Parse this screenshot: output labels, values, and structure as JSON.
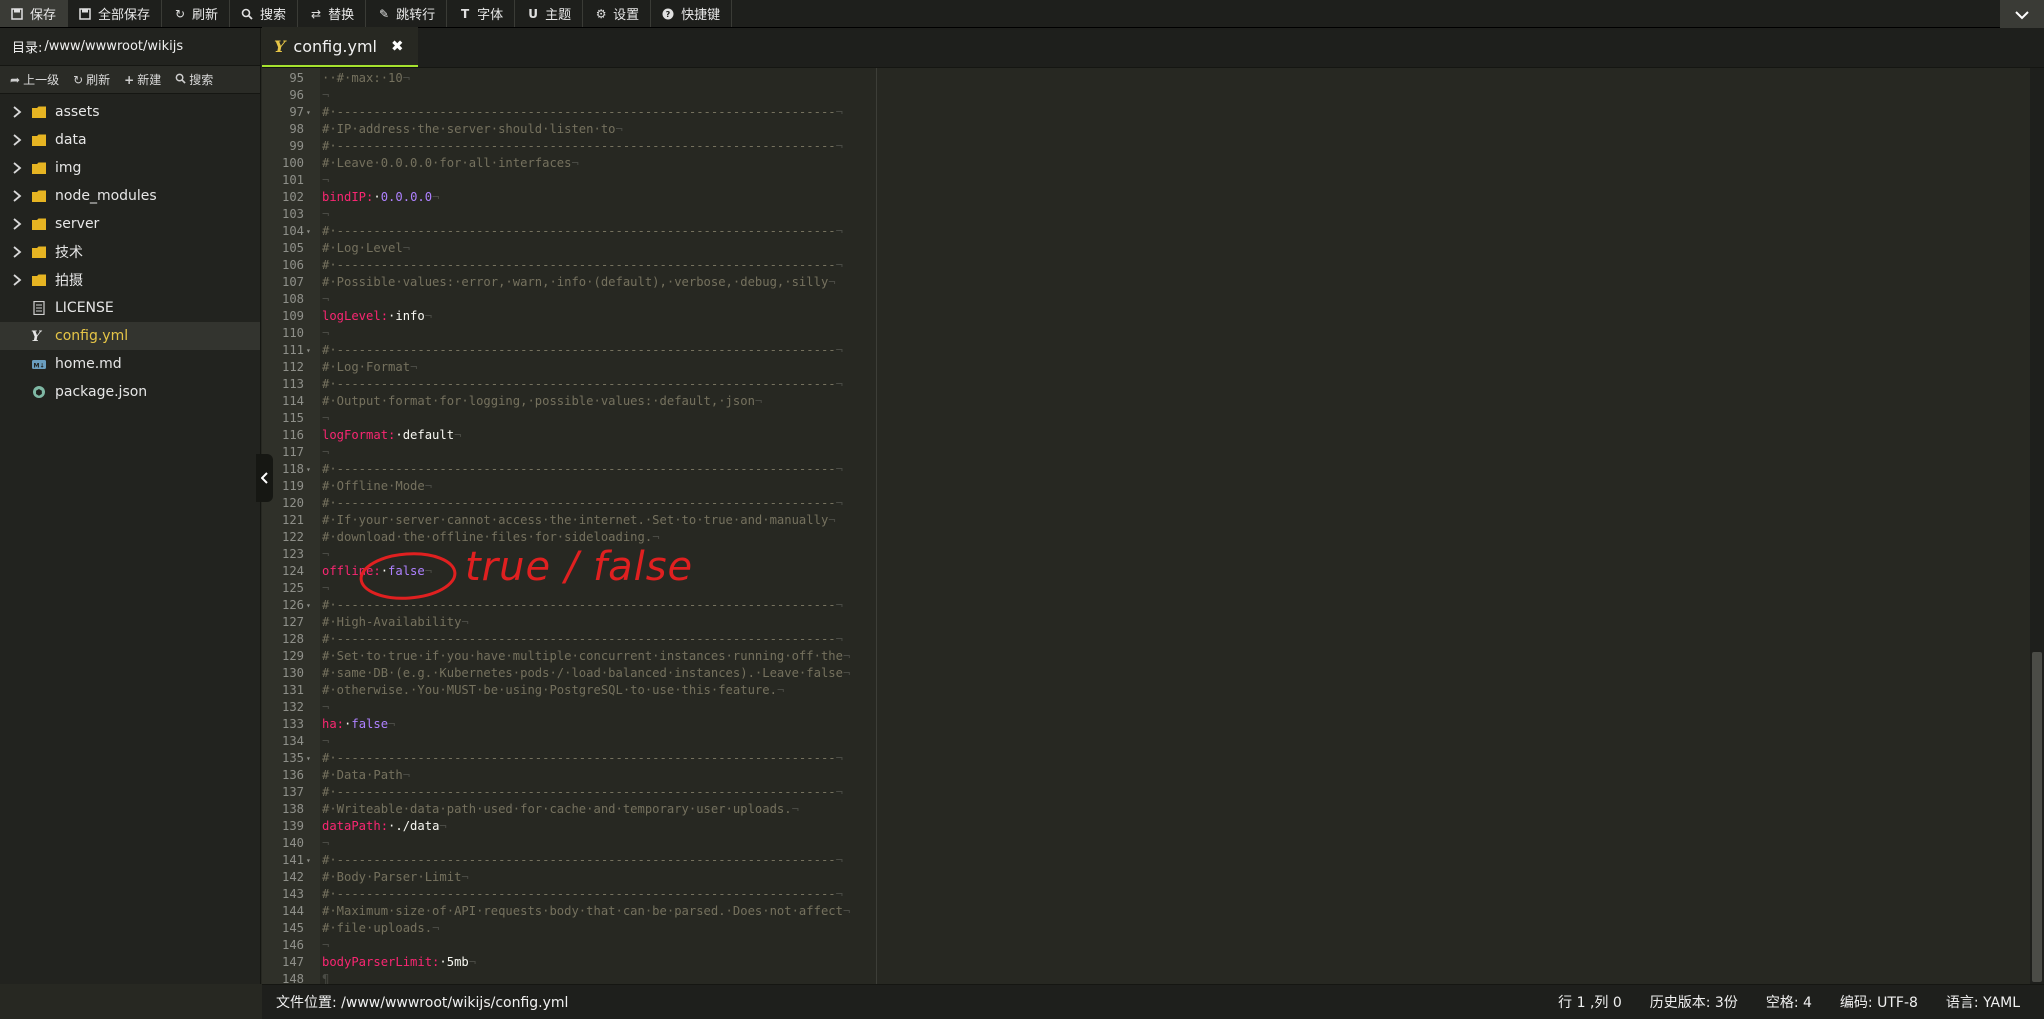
{
  "toolbar": {
    "items": [
      {
        "label": "保存",
        "icon": "save-icon"
      },
      {
        "label": "全部保存",
        "icon": "save-all-icon"
      },
      {
        "label": "刷新",
        "icon": "refresh-icon"
      },
      {
        "label": "搜索",
        "icon": "search-icon"
      },
      {
        "label": "替换",
        "icon": "replace-icon"
      },
      {
        "label": "跳转行",
        "icon": "goto-line-icon"
      },
      {
        "label": "字体",
        "icon": "font-icon"
      },
      {
        "label": "主题",
        "icon": "theme-icon"
      },
      {
        "label": "设置",
        "icon": "gear-icon"
      },
      {
        "label": "快捷键",
        "icon": "help-icon"
      }
    ],
    "collapse_icon": "chevron-down-icon"
  },
  "sidebar": {
    "dir_label": "目录:",
    "dir_path": "/www/wwwroot/wikijs",
    "actions": [
      {
        "label": "上一级",
        "icon": "up-level-icon"
      },
      {
        "label": "刷新",
        "icon": "refresh-icon"
      },
      {
        "label": "新建",
        "icon": "plus-icon"
      },
      {
        "label": "搜索",
        "icon": "search-icon"
      }
    ],
    "tree": [
      {
        "name": "assets",
        "type": "folder"
      },
      {
        "name": "data",
        "type": "folder"
      },
      {
        "name": "img",
        "type": "folder"
      },
      {
        "name": "node_modules",
        "type": "folder"
      },
      {
        "name": "server",
        "type": "folder"
      },
      {
        "name": "技术",
        "type": "folder"
      },
      {
        "name": "拍摄",
        "type": "folder"
      },
      {
        "name": "LICENSE",
        "type": "file-text"
      },
      {
        "name": "config.yml",
        "type": "file-yaml",
        "active": true
      },
      {
        "name": "home.md",
        "type": "file-markdown"
      },
      {
        "name": "package.json",
        "type": "file-json"
      }
    ]
  },
  "editor": {
    "tab": {
      "label": "config.yml",
      "close": "✖"
    },
    "lines": [
      {
        "n": "95",
        "segs": [
          [
            "c-com",
            "··#·max:·10"
          ],
          [
            "c-inv",
            "¬"
          ]
        ]
      },
      {
        "n": "96",
        "segs": [
          [
            "c-inv",
            "¬"
          ]
        ]
      },
      {
        "n": "97",
        "fold": true,
        "segs": [
          [
            "c-com",
            "#·--------------------------------------------------------------------"
          ],
          [
            "c-inv",
            "¬"
          ]
        ]
      },
      {
        "n": "98",
        "segs": [
          [
            "c-com",
            "#·IP·address·the·server·should·listen·to"
          ],
          [
            "c-inv",
            "¬"
          ]
        ]
      },
      {
        "n": "99",
        "segs": [
          [
            "c-com",
            "#·--------------------------------------------------------------------"
          ],
          [
            "c-inv",
            "¬"
          ]
        ]
      },
      {
        "n": "100",
        "segs": [
          [
            "c-com",
            "#·Leave·0.0.0.0·for·all·interfaces"
          ],
          [
            "c-inv",
            "¬"
          ]
        ]
      },
      {
        "n": "101",
        "segs": [
          [
            "c-inv",
            "¬"
          ]
        ]
      },
      {
        "n": "102",
        "segs": [
          [
            "c-key",
            "bindIP:"
          ],
          [
            "c-str",
            "·"
          ],
          [
            "c-num",
            "0.0.0.0"
          ],
          [
            "c-inv",
            "¬"
          ]
        ]
      },
      {
        "n": "103",
        "segs": [
          [
            "c-inv",
            "¬"
          ]
        ]
      },
      {
        "n": "104",
        "fold": true,
        "segs": [
          [
            "c-com",
            "#·--------------------------------------------------------------------"
          ],
          [
            "c-inv",
            "¬"
          ]
        ]
      },
      {
        "n": "105",
        "segs": [
          [
            "c-com",
            "#·Log·Level"
          ],
          [
            "c-inv",
            "¬"
          ]
        ]
      },
      {
        "n": "106",
        "segs": [
          [
            "c-com",
            "#·--------------------------------------------------------------------"
          ],
          [
            "c-inv",
            "¬"
          ]
        ]
      },
      {
        "n": "107",
        "segs": [
          [
            "c-com",
            "#·Possible·values:·error,·warn,·info·(default),·verbose,·debug,·silly"
          ],
          [
            "c-inv",
            "¬"
          ]
        ]
      },
      {
        "n": "108",
        "segs": [
          [
            "c-inv",
            "¬"
          ]
        ]
      },
      {
        "n": "109",
        "segs": [
          [
            "c-key",
            "logLevel:"
          ],
          [
            "c-str",
            "·info"
          ],
          [
            "c-inv",
            "¬"
          ]
        ]
      },
      {
        "n": "110",
        "segs": [
          [
            "c-inv",
            "¬"
          ]
        ]
      },
      {
        "n": "111",
        "fold": true,
        "segs": [
          [
            "c-com",
            "#·--------------------------------------------------------------------"
          ],
          [
            "c-inv",
            "¬"
          ]
        ]
      },
      {
        "n": "112",
        "segs": [
          [
            "c-com",
            "#·Log·Format"
          ],
          [
            "c-inv",
            "¬"
          ]
        ]
      },
      {
        "n": "113",
        "segs": [
          [
            "c-com",
            "#·--------------------------------------------------------------------"
          ],
          [
            "c-inv",
            "¬"
          ]
        ]
      },
      {
        "n": "114",
        "segs": [
          [
            "c-com",
            "#·Output·format·for·logging,·possible·values:·default,·json"
          ],
          [
            "c-inv",
            "¬"
          ]
        ]
      },
      {
        "n": "115",
        "segs": [
          [
            "c-inv",
            "¬"
          ]
        ]
      },
      {
        "n": "116",
        "segs": [
          [
            "c-key",
            "logFormat:"
          ],
          [
            "c-str",
            "·default"
          ],
          [
            "c-inv",
            "¬"
          ]
        ]
      },
      {
        "n": "117",
        "segs": [
          [
            "c-inv",
            "¬"
          ]
        ]
      },
      {
        "n": "118",
        "fold": true,
        "segs": [
          [
            "c-com",
            "#·--------------------------------------------------------------------"
          ],
          [
            "c-inv",
            "¬"
          ]
        ]
      },
      {
        "n": "119",
        "segs": [
          [
            "c-com",
            "#·Offline·Mode"
          ],
          [
            "c-inv",
            "¬"
          ]
        ]
      },
      {
        "n": "120",
        "segs": [
          [
            "c-com",
            "#·--------------------------------------------------------------------"
          ],
          [
            "c-inv",
            "¬"
          ]
        ]
      },
      {
        "n": "121",
        "segs": [
          [
            "c-com",
            "#·If·your·server·cannot·access·the·internet.·Set·to·true·and·manually"
          ],
          [
            "c-inv",
            "¬"
          ]
        ]
      },
      {
        "n": "122",
        "segs": [
          [
            "c-com",
            "#·download·the·offline·files·for·sideloading."
          ],
          [
            "c-inv",
            "¬"
          ]
        ]
      },
      {
        "n": "123",
        "segs": [
          [
            "c-inv",
            "¬"
          ]
        ]
      },
      {
        "n": "124",
        "segs": [
          [
            "c-key",
            "offline:"
          ],
          [
            "c-str",
            "·"
          ],
          [
            "c-num",
            "false"
          ],
          [
            "c-inv",
            "¬"
          ]
        ]
      },
      {
        "n": "125",
        "segs": [
          [
            "c-inv",
            "¬"
          ]
        ]
      },
      {
        "n": "126",
        "fold": true,
        "segs": [
          [
            "c-com",
            "#·--------------------------------------------------------------------"
          ],
          [
            "c-inv",
            "¬"
          ]
        ]
      },
      {
        "n": "127",
        "segs": [
          [
            "c-com",
            "#·High-Availability"
          ],
          [
            "c-inv",
            "¬"
          ]
        ]
      },
      {
        "n": "128",
        "segs": [
          [
            "c-com",
            "#·--------------------------------------------------------------------"
          ],
          [
            "c-inv",
            "¬"
          ]
        ]
      },
      {
        "n": "129",
        "segs": [
          [
            "c-com",
            "#·Set·to·true·if·you·have·multiple·concurrent·instances·running·off·the"
          ],
          [
            "c-inv",
            "¬"
          ]
        ]
      },
      {
        "n": "130",
        "segs": [
          [
            "c-com",
            "#·same·DB·(e.g.·Kubernetes·pods·/·load·balanced·instances).·Leave·false"
          ],
          [
            "c-inv",
            "¬"
          ]
        ]
      },
      {
        "n": "131",
        "segs": [
          [
            "c-com",
            "#·otherwise.·You·MUST·be·using·PostgreSQL·to·use·this·feature."
          ],
          [
            "c-inv",
            "¬"
          ]
        ]
      },
      {
        "n": "132",
        "segs": [
          [
            "c-inv",
            "¬"
          ]
        ]
      },
      {
        "n": "133",
        "segs": [
          [
            "c-key",
            "ha:"
          ],
          [
            "c-str",
            "·"
          ],
          [
            "c-num",
            "false"
          ],
          [
            "c-inv",
            "¬"
          ]
        ]
      },
      {
        "n": "134",
        "segs": [
          [
            "c-inv",
            "¬"
          ]
        ]
      },
      {
        "n": "135",
        "fold": true,
        "segs": [
          [
            "c-com",
            "#·--------------------------------------------------------------------"
          ],
          [
            "c-inv",
            "¬"
          ]
        ]
      },
      {
        "n": "136",
        "segs": [
          [
            "c-com",
            "#·Data·Path"
          ],
          [
            "c-inv",
            "¬"
          ]
        ]
      },
      {
        "n": "137",
        "segs": [
          [
            "c-com",
            "#·--------------------------------------------------------------------"
          ],
          [
            "c-inv",
            "¬"
          ]
        ]
      },
      {
        "n": "138",
        "segs": [
          [
            "c-com",
            "#·Writeable·data·path·used·for·cache·and·temporary·user·uploads."
          ],
          [
            "c-inv",
            "¬"
          ]
        ]
      },
      {
        "n": "139",
        "segs": [
          [
            "c-key",
            "dataPath:"
          ],
          [
            "c-str",
            "·./data"
          ],
          [
            "c-inv",
            "¬"
          ]
        ]
      },
      {
        "n": "140",
        "segs": [
          [
            "c-inv",
            "¬"
          ]
        ]
      },
      {
        "n": "141",
        "fold": true,
        "segs": [
          [
            "c-com",
            "#·--------------------------------------------------------------------"
          ],
          [
            "c-inv",
            "¬"
          ]
        ]
      },
      {
        "n": "142",
        "segs": [
          [
            "c-com",
            "#·Body·Parser·Limit"
          ],
          [
            "c-inv",
            "¬"
          ]
        ]
      },
      {
        "n": "143",
        "segs": [
          [
            "c-com",
            "#·--------------------------------------------------------------------"
          ],
          [
            "c-inv",
            "¬"
          ]
        ]
      },
      {
        "n": "144",
        "segs": [
          [
            "c-com",
            "#·Maximum·size·of·API·requests·body·that·can·be·parsed.·Does·not·affect"
          ],
          [
            "c-inv",
            "¬"
          ]
        ]
      },
      {
        "n": "145",
        "segs": [
          [
            "c-com",
            "#·file·uploads."
          ],
          [
            "c-inv",
            "¬"
          ]
        ]
      },
      {
        "n": "146",
        "segs": [
          [
            "c-inv",
            "¬"
          ]
        ]
      },
      {
        "n": "147",
        "segs": [
          [
            "c-key",
            "bodyParserLimit:"
          ],
          [
            "c-str",
            "·5mb"
          ],
          [
            "c-inv",
            "¬"
          ]
        ]
      },
      {
        "n": "148",
        "segs": [
          [
            "c-inv",
            "¶"
          ]
        ]
      }
    ]
  },
  "annotation": {
    "text": "true / false",
    "color": "#e02020"
  },
  "statusbar": {
    "file_location": "文件位置: /www/wwwroot/wikijs/config.yml",
    "cursor": "行 1 ,列 0",
    "history": "历史版本: 3份",
    "indent": "空格: 4",
    "encoding": "编码: UTF-8",
    "language": "语言: YAML"
  },
  "colors": {
    "accent_tab": "#a6e22e",
    "active_file": "#e6c547",
    "folder": "#e6b422",
    "comment": "#75715e",
    "key": "#f92672",
    "literal": "#ae81ff"
  }
}
